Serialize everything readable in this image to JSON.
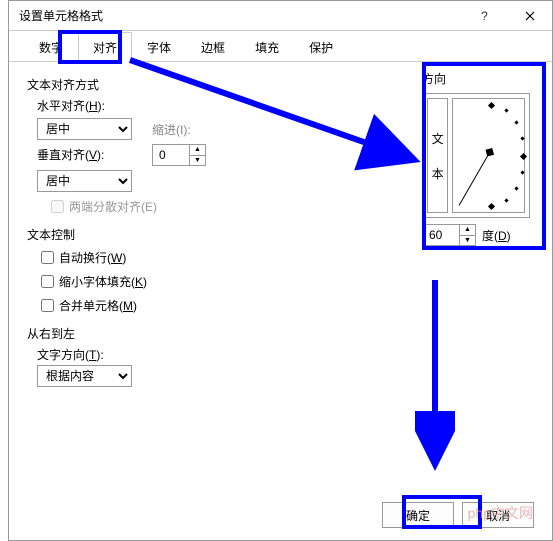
{
  "window": {
    "title": "设置单元格格式",
    "help": "?",
    "close": "×"
  },
  "tabs": {
    "number": "数字",
    "align": "对齐",
    "font": "字体",
    "border": "边框",
    "fill": "填充",
    "protect": "保护"
  },
  "align": {
    "section": "文本对齐方式",
    "h_label": "水平对齐(",
    "h_key": "H",
    "h_end": "):",
    "h_value": "居中",
    "indent_label": "缩进(",
    "indent_key": "I",
    "indent_end": "):",
    "indent_value": "0",
    "v_label": "垂直对齐(",
    "v_key": "V",
    "v_end": "):",
    "v_value": "居中",
    "justify": "两端分散对齐(",
    "justify_key": "E",
    "justify_end": ")"
  },
  "control": {
    "section": "文本控制",
    "wrap": "自动换行(",
    "wrap_key": "W",
    "wrap_end": ")",
    "shrink": "缩小字体填充(",
    "shrink_key": "K",
    "shrink_end": ")",
    "merge": "合并单元格(",
    "merge_key": "M",
    "merge_end": ")"
  },
  "rtl": {
    "section": "从右到左",
    "dir_label": "文字方向(",
    "dir_key": "T",
    "dir_end": "):",
    "dir_value": "根据内容"
  },
  "orient": {
    "section": "方向",
    "vtext1": "文",
    "vtext2": "本",
    "deg_value": "60",
    "deg_label": "度(",
    "deg_key": "D",
    "deg_end": ")"
  },
  "chart_data": {
    "type": "other",
    "angle_degrees": 60
  },
  "buttons": {
    "ok": "确定",
    "cancel": "取消"
  },
  "watermark": "php中文网"
}
